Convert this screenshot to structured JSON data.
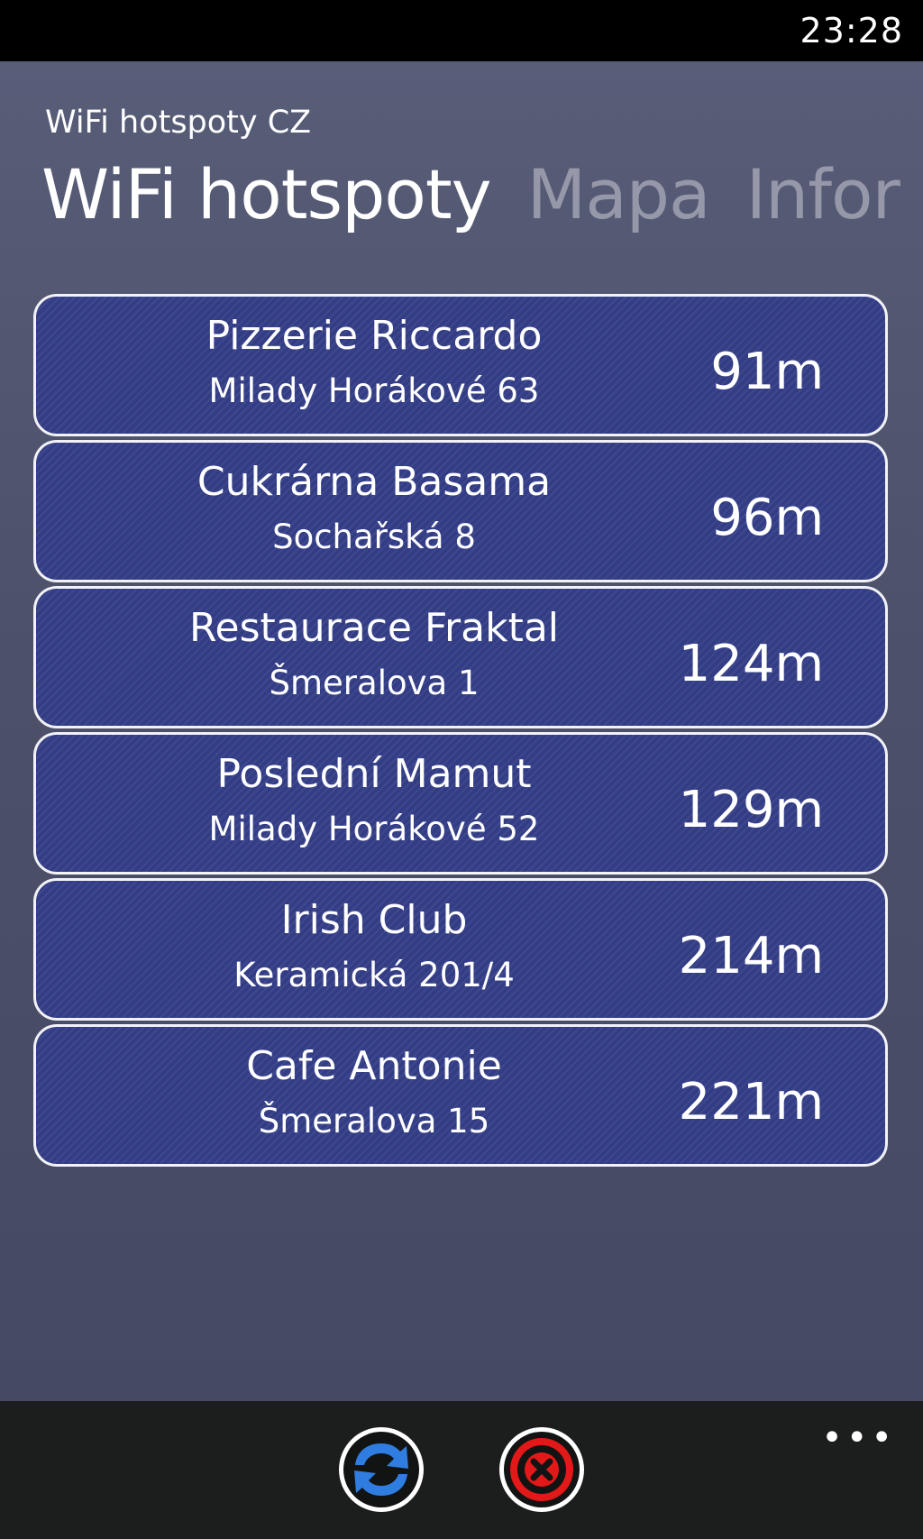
{
  "status_bar": {
    "time": "23:28"
  },
  "app": {
    "title": "WiFi hotspoty CZ"
  },
  "pivot": {
    "tabs": [
      {
        "label": "WiFi hotspoty",
        "active": true
      },
      {
        "label": "Mapa",
        "active": false
      },
      {
        "label": "Infor",
        "active": false
      }
    ]
  },
  "hotspots": [
    {
      "name": "Pizzerie Riccardo",
      "address": "Milady Horákové 63",
      "distance": "91m"
    },
    {
      "name": "Cukrárna Basama",
      "address": "Sochařská 8",
      "distance": "96m"
    },
    {
      "name": "Restaurace Fraktal",
      "address": "Šmeralova 1",
      "distance": "124m"
    },
    {
      "name": "Poslední Mamut",
      "address": "Milady Horákové 52",
      "distance": "129m"
    },
    {
      "name": "Irish Club",
      "address": "Keramická 201/4",
      "distance": "214m"
    },
    {
      "name": "Cafe Antonie",
      "address": "Šmeralova 15",
      "distance": "221m"
    }
  ],
  "app_bar": {
    "more_label": "•••",
    "buttons": [
      {
        "icon": "refresh-icon"
      },
      {
        "icon": "stop-icon"
      }
    ]
  },
  "colors": {
    "card_fill": "#333d85",
    "card_border": "#f2f2f6",
    "page_background": "#4a4e68",
    "app_bar": "#1c1e1e",
    "refresh_accent": "#2f7de0",
    "stop_accent": "#e31818"
  }
}
